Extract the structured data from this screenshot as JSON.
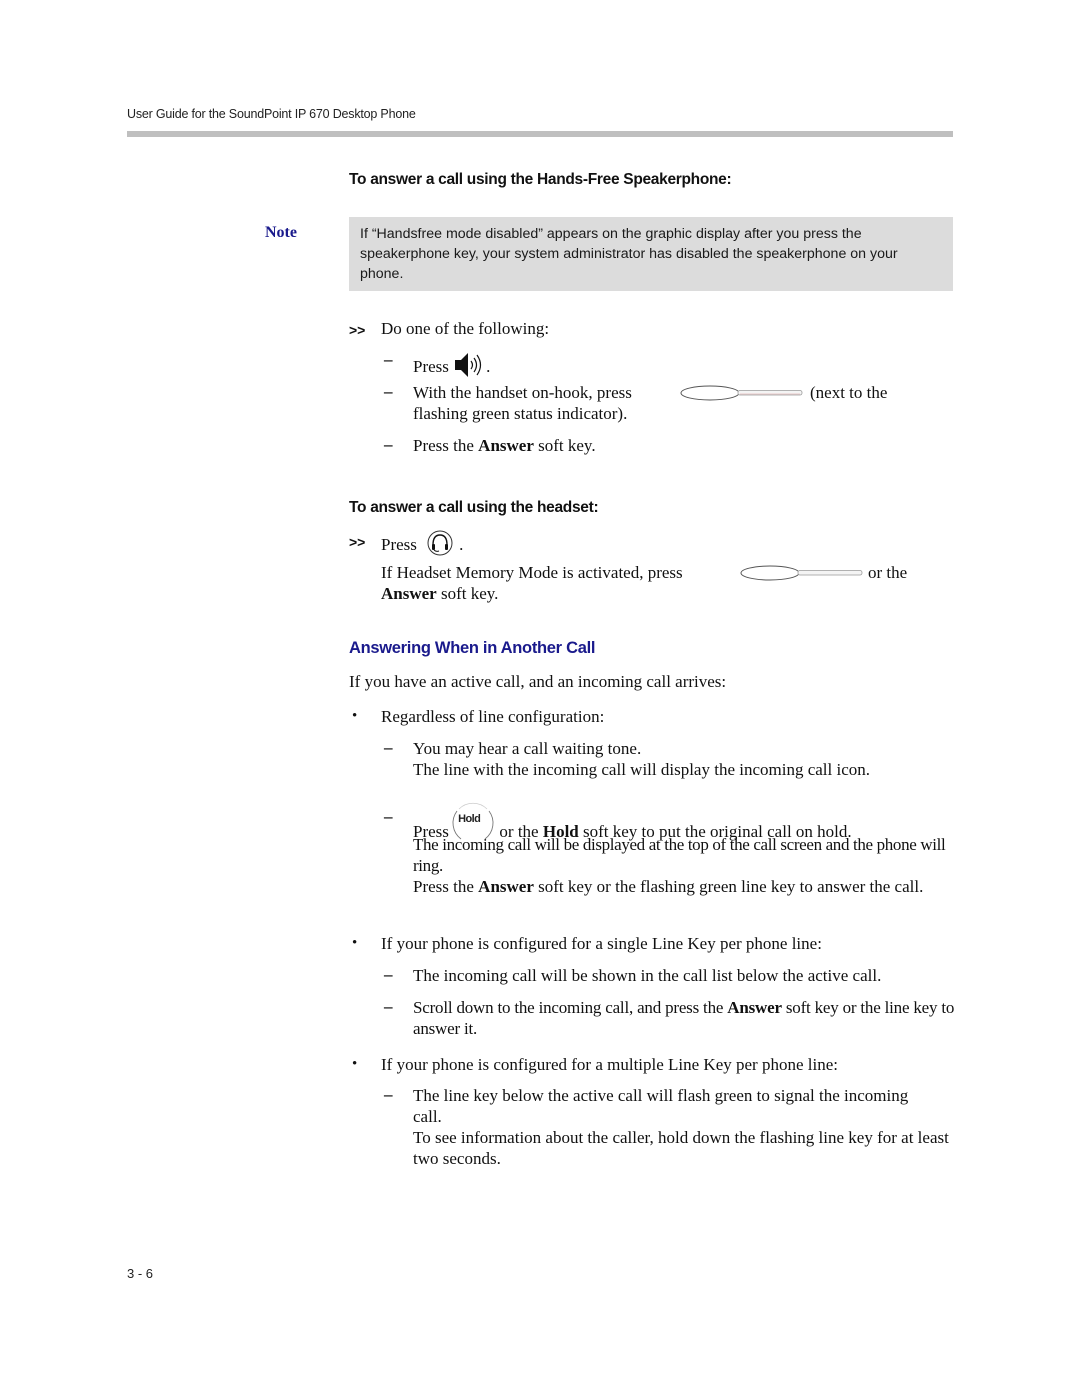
{
  "running_header": "User Guide for the SoundPoint IP 670 Desktop Phone",
  "page_number": "3 - 6",
  "section1": {
    "heading": "To answer a call using the Hands-Free Speakerphone:",
    "note_label": "Note",
    "note_text": "If “Handsfree mode disabled” appears on the graphic display after you press the speakerphone key, your system administrator has disabled the speakerphone on your phone.",
    "step_marker": ">>",
    "step_text": "Do one of the following:",
    "options": [
      {
        "marker": "–",
        "before": "Press",
        "icon": "speaker-icon",
        "after": "."
      },
      {
        "marker": "–",
        "before": "With the handset on-hook, press",
        "icon": "line-key-icon",
        "after": "(next to the",
        "continuation": "flashing green status indicator)."
      },
      {
        "marker": "–",
        "before": "Press the ",
        "bold": "Answer",
        "after": " soft key."
      }
    ]
  },
  "section2": {
    "heading": "To answer a call using the headset:",
    "step_marker": ">>",
    "step_before": "Press",
    "step_icon": "headset-icon",
    "step_after": ".",
    "memory_before": "If Headset Memory Mode is activated, press",
    "memory_icon": "line-key-icon",
    "memory_after": "or the",
    "memory_bold": "Answer",
    "memory_end": " soft key."
  },
  "section3": {
    "heading": "Answering When in Another Call",
    "intro": "If you have an active call, and an incoming call arrives:",
    "bullets": [
      {
        "marker": "•",
        "text": "Regardless of line configuration:",
        "items": [
          {
            "marker": "–",
            "lines": [
              "You may hear a call waiting tone.",
              "The line with the incoming call will display the incoming call icon."
            ]
          },
          {
            "marker": "–",
            "before": "Press",
            "icon_label": "Hold",
            "mid": " or the ",
            "bold": "Hold",
            "after": " soft key to put the original call on hold.",
            "para1": "The incoming call will be displayed at the top of the call screen and the phone will ring.",
            "para2_before": "Press the ",
            "para2_bold": "Answer",
            "para2_after": " soft key or the flashing green line key to answer the call."
          }
        ]
      },
      {
        "marker": "•",
        "text": "If your phone is configured for a single Line Key per phone line:",
        "items": [
          {
            "marker": "–",
            "text": "The incoming call will be shown in the call list below the active call."
          },
          {
            "marker": "–",
            "before": "Scroll down to the incoming call, and press the ",
            "bold": "Answer",
            "after": " soft key or the line key to answer it."
          }
        ]
      },
      {
        "marker": "•",
        "text": "If your phone is configured for a multiple Line Key per phone line:",
        "items": [
          {
            "marker": "–",
            "para1": "The line key below the active call will flash green to signal the incoming call.",
            "para2": "To see information about the caller, hold down the flashing line key for at least two seconds."
          }
        ]
      }
    ]
  }
}
